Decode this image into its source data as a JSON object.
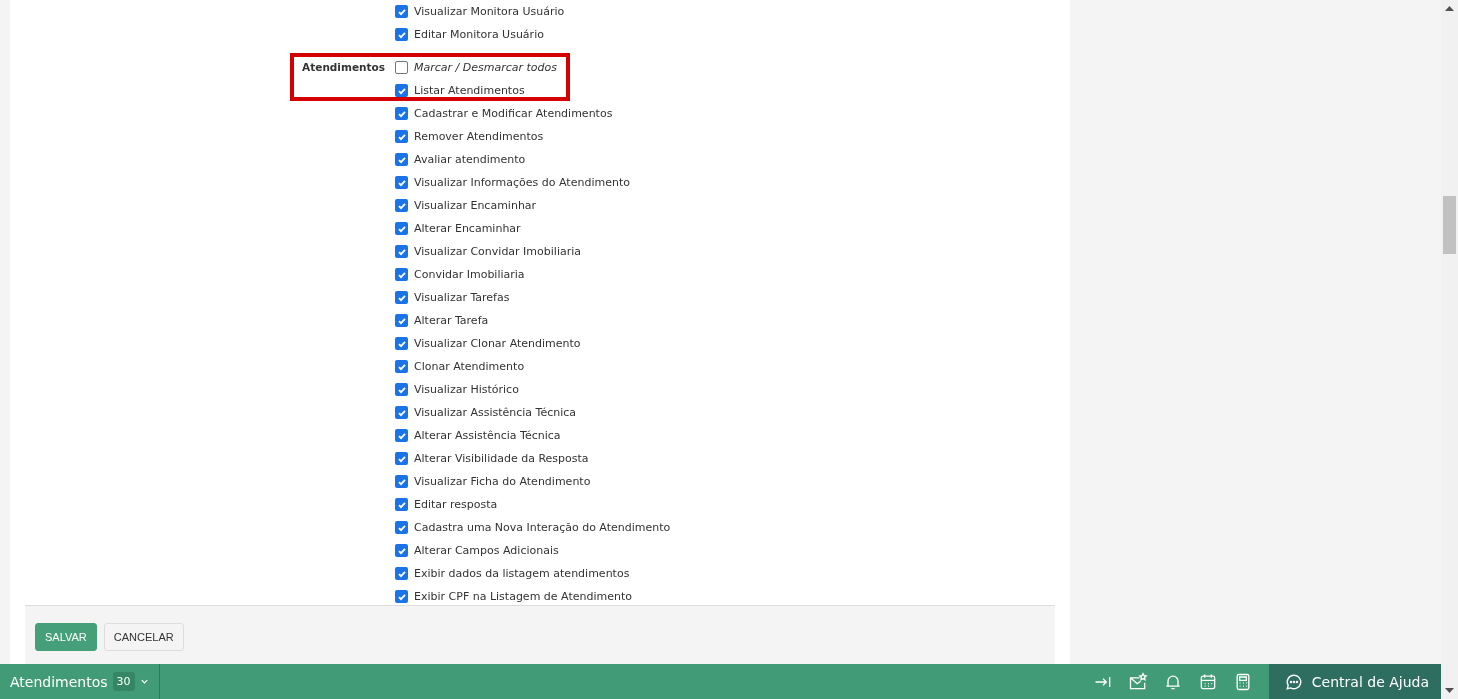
{
  "permission_groups": [
    {
      "items": [
        {
          "label": "Visualizar Monitora Usuário",
          "checked": true
        },
        {
          "label": "Editar Monitora Usuário",
          "checked": true
        }
      ]
    },
    {
      "label": "Atendimentos",
      "highlighted": true,
      "items": [
        {
          "label": "Marcar / Desmarcar todos",
          "checked": false,
          "kind": "toggle-all"
        },
        {
          "label": "Listar Atendimentos",
          "checked": true
        },
        {
          "label": "Cadastrar e Modificar Atendimentos",
          "checked": true
        },
        {
          "label": "Remover Atendimentos",
          "checked": true
        },
        {
          "label": "Avaliar atendimento",
          "checked": true
        },
        {
          "label": "Visualizar Informações do Atendimento",
          "checked": true
        },
        {
          "label": "Visualizar Encaminhar",
          "checked": true
        },
        {
          "label": "Alterar Encaminhar",
          "checked": true
        },
        {
          "label": "Visualizar Convidar Imobiliaria",
          "checked": true
        },
        {
          "label": "Convidar Imobiliaria",
          "checked": true
        },
        {
          "label": "Visualizar Tarefas",
          "checked": true
        },
        {
          "label": "Alterar Tarefa",
          "checked": true
        },
        {
          "label": "Visualizar Clonar Atendimento",
          "checked": true
        },
        {
          "label": "Clonar Atendimento",
          "checked": true
        },
        {
          "label": "Visualizar Histórico",
          "checked": true
        },
        {
          "label": "Visualizar Assistência Técnica",
          "checked": true
        },
        {
          "label": "Alterar Assistência Técnica",
          "checked": true
        },
        {
          "label": "Alterar Visibilidade da Resposta",
          "checked": true
        },
        {
          "label": "Visualizar Ficha do Atendimento",
          "checked": true
        },
        {
          "label": "Editar resposta",
          "checked": true
        },
        {
          "label": "Cadastra uma Nova Interação do Atendimento",
          "checked": true
        },
        {
          "label": "Alterar Campos Adicionais",
          "checked": true
        },
        {
          "label": "Exibir dados da listagem atendimentos",
          "checked": true
        },
        {
          "label": "Exibir CPF na Listagem de Atendimento",
          "checked": true
        }
      ]
    }
  ],
  "form_buttons": [
    {
      "label": "SALVAR",
      "kind": "primary"
    },
    {
      "label": "CANCELAR",
      "kind": "secondary"
    }
  ],
  "bottom_bar": {
    "module": "Atendimentos",
    "count": "30",
    "help": "Central de Ajuda"
  }
}
